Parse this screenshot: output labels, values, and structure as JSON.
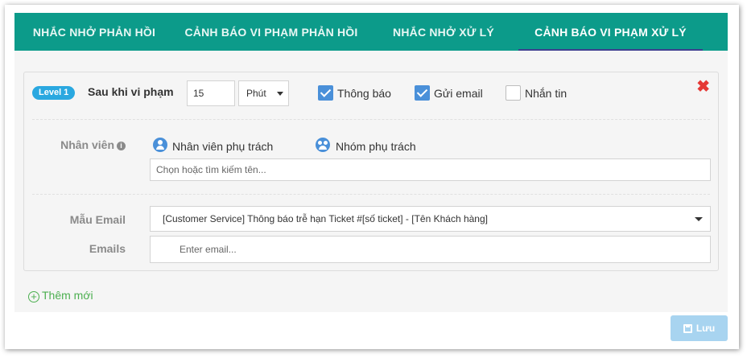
{
  "tabs": [
    {
      "label": "NHẮC NHỞ PHẢN HỒI"
    },
    {
      "label": "CẢNH BÁO VI PHẠM PHẢN HỒI"
    },
    {
      "label": "NHẮC NHỞ XỬ LÝ"
    },
    {
      "label": "CẢNH BÁO VI PHẠM XỬ LÝ"
    }
  ],
  "rule": {
    "level_badge": "Level 1",
    "after_label": "Sau khi vi phạm",
    "time_value": "15",
    "time_unit": "Phút",
    "options": [
      {
        "label": "Thông báo",
        "checked": true
      },
      {
        "label": "Gửi email",
        "checked": true
      },
      {
        "label": "Nhắn tin",
        "checked": false
      }
    ],
    "close_symbol": "✖",
    "staff": {
      "label": "Nhân viên",
      "info_symbol": "i",
      "person_option": "Nhân viên phụ trách",
      "group_option": "Nhóm phụ trách",
      "search_placeholder": "Chọn hoặc tìm kiếm tên..."
    },
    "email_template": {
      "label": "Mẫu Email",
      "selected": "[Customer Service] Thông báo trễ hạn Ticket #[số ticket] - [Tên Khách hàng]"
    },
    "emails": {
      "label": "Emails",
      "placeholder": "Enter email..."
    }
  },
  "add_new_label": "Thêm mới",
  "add_new_symbol": "+",
  "save_label": "Lưu",
  "colors": {
    "tab_bar": "#0c9b8a",
    "active_underline": "#3d3f8f",
    "badge": "#2aa8e0",
    "checkbox": "#4a90d9",
    "close": "#e53935",
    "add_new": "#4caf50",
    "save_button": "#a8d4f0"
  },
  "icons": [
    "info-icon",
    "user-icon",
    "group-icon",
    "close-icon",
    "plus-circle-icon",
    "save-icon",
    "caret-down-icon",
    "check-icon"
  ]
}
